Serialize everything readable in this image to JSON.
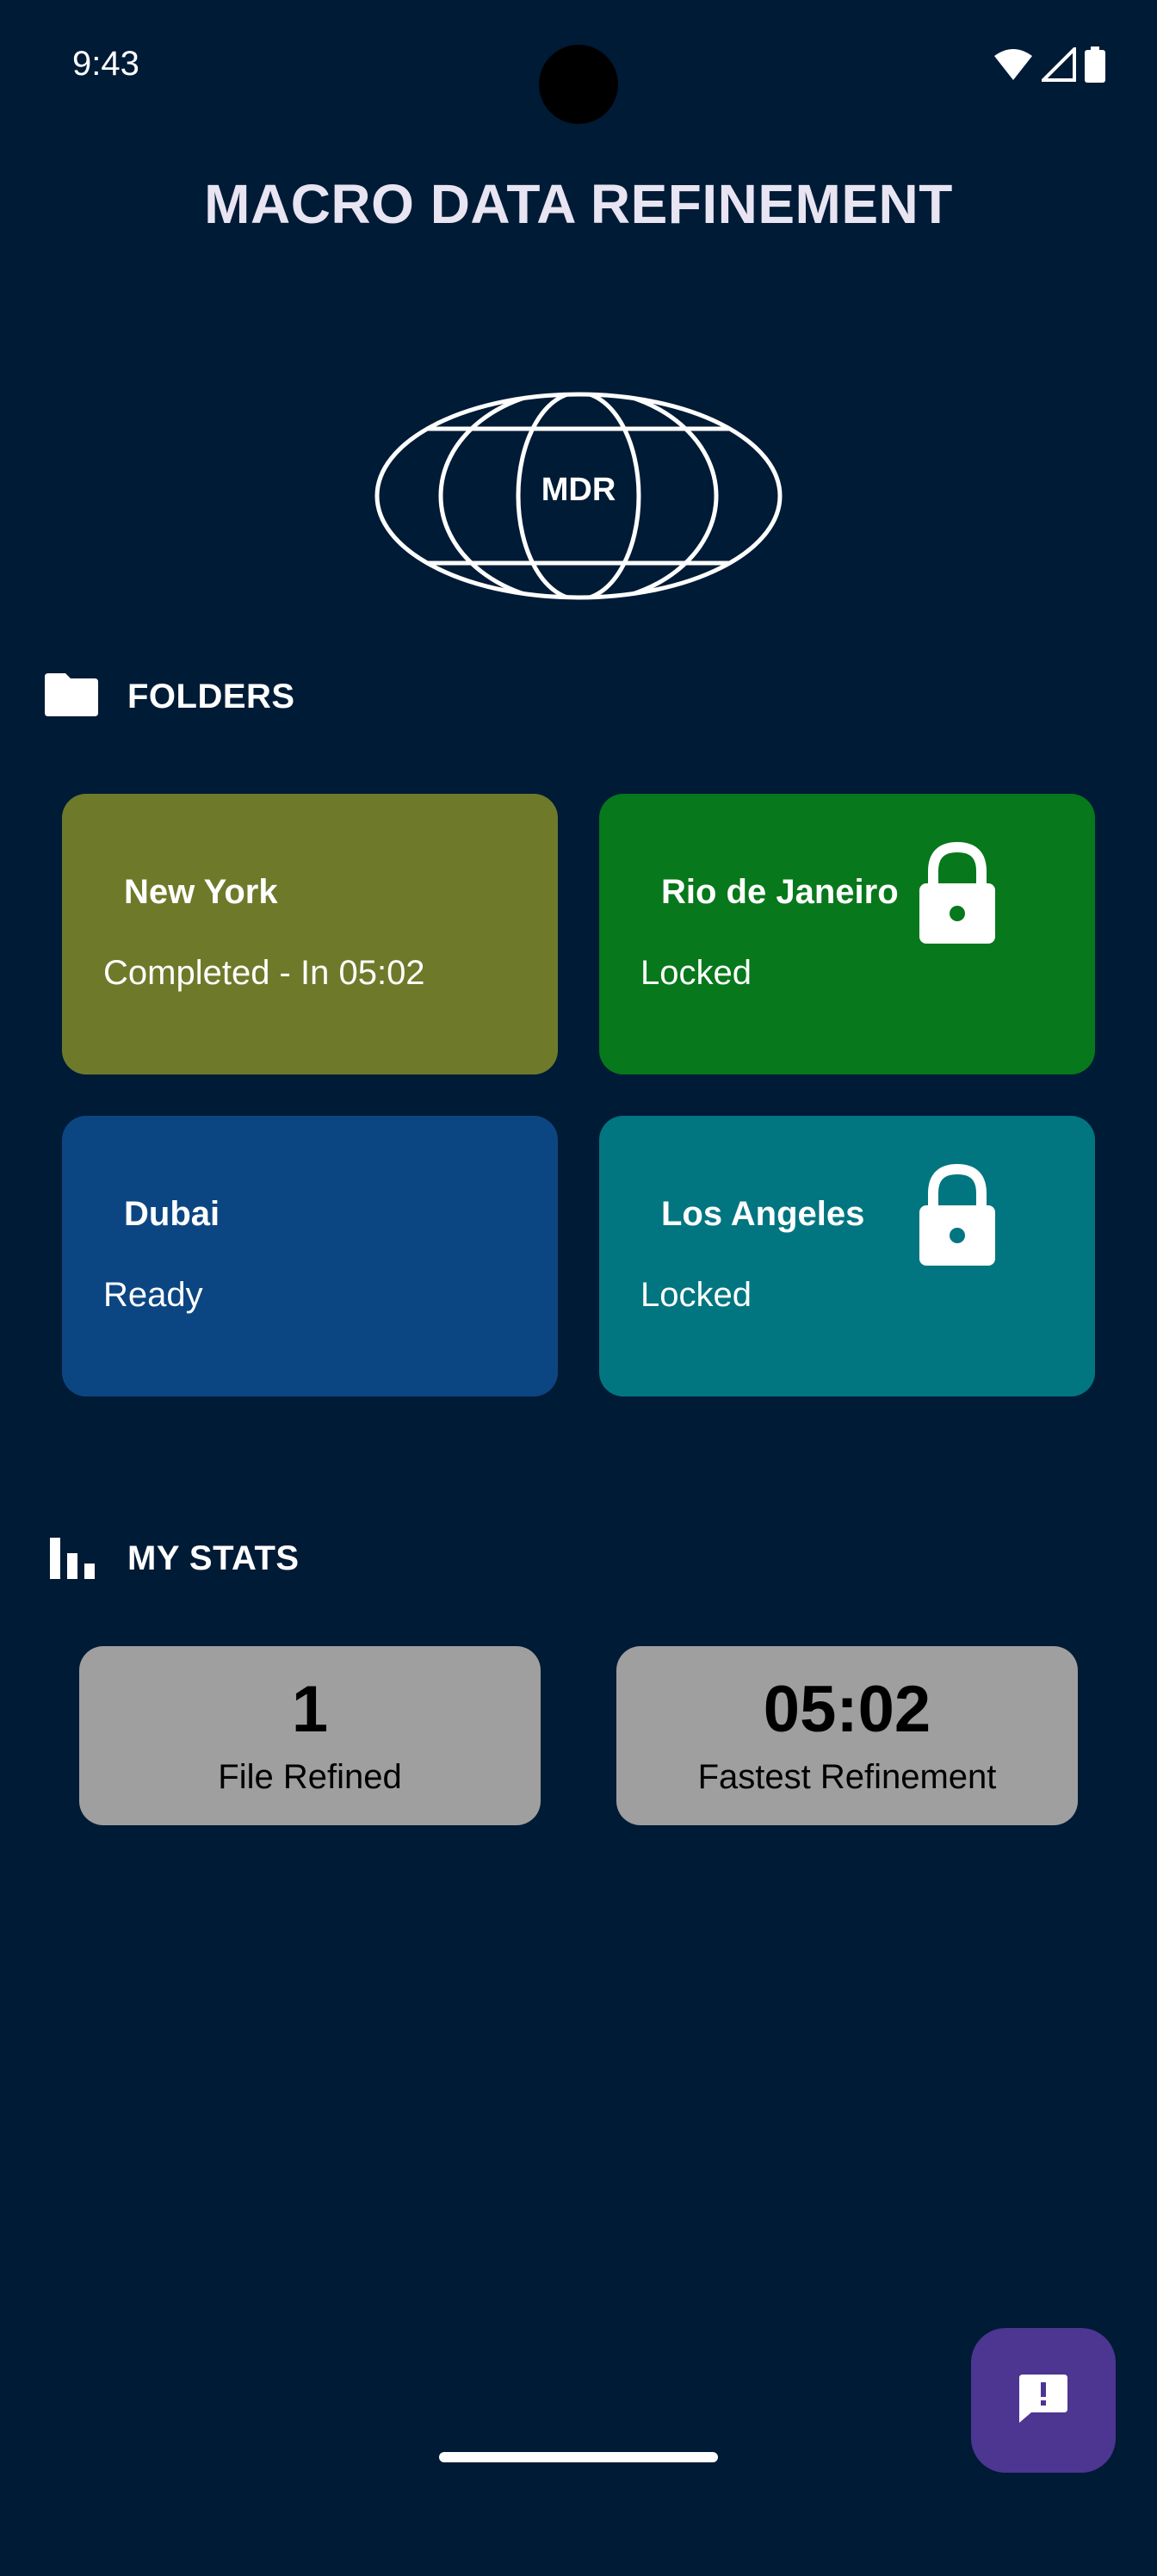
{
  "status_bar": {
    "time": "9:43",
    "icons": [
      "wifi-icon",
      "cellular-signal-icon",
      "battery-icon"
    ]
  },
  "header": {
    "title": "MACRO DATA REFINEMENT"
  },
  "logo": {
    "text": "MDR",
    "icon": "globe-logo-icon"
  },
  "folders_section": {
    "label": "FOLDERS",
    "icon": "folder-icon",
    "items": [
      {
        "name": "New York",
        "status": "Completed - In 05:02",
        "locked": false,
        "color": "#6e7a2a"
      },
      {
        "name": "Rio de Janeiro",
        "status": "Locked",
        "locked": true,
        "color": "#07781b"
      },
      {
        "name": "Dubai",
        "status": "Ready",
        "locked": false,
        "color": "#0c4682"
      },
      {
        "name": "Los Angeles",
        "status": "Locked",
        "locked": true,
        "color": "#027680"
      }
    ]
  },
  "stats_section": {
    "label": "MY STATS",
    "icon": "bar-chart-icon",
    "items": [
      {
        "value": "1",
        "label": "File Refined"
      },
      {
        "value": "05:02",
        "label": "Fastest Refinement"
      }
    ]
  },
  "fab": {
    "icon": "feedback-icon",
    "color": "#4d3592"
  },
  "colors": {
    "background": "#001b36",
    "stat_card": "#9f9f9f"
  }
}
